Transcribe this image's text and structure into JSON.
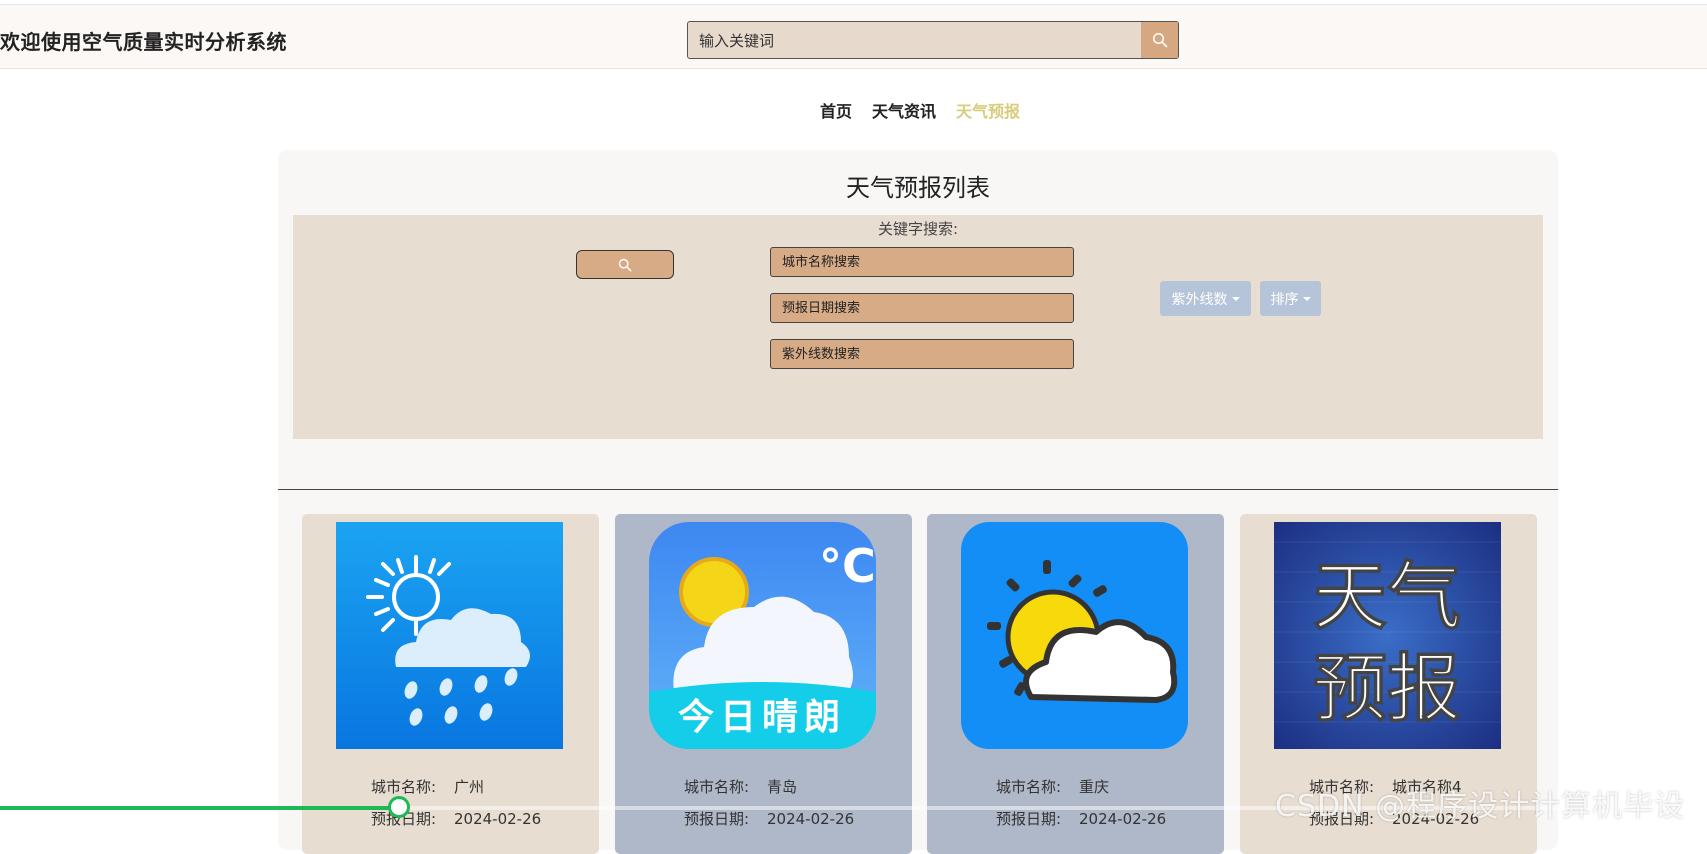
{
  "header": {
    "site_title": "欢迎使用空气质量实时分析系统",
    "search_placeholder": "输入关键词"
  },
  "nav": {
    "items": [
      {
        "label": "首页",
        "active": false
      },
      {
        "label": "天气资讯",
        "active": false
      },
      {
        "label": "天气预报",
        "active": true
      }
    ]
  },
  "page": {
    "title": "天气预报列表",
    "filter": {
      "label": "关键字搜索:",
      "city_placeholder": "城市名称搜索",
      "date_placeholder": "预报日期搜索",
      "uv_placeholder": "紫外线数搜索",
      "uv_dropdown": "紫外线数",
      "sort_dropdown": "排序"
    }
  },
  "labels": {
    "city": "城市名称:",
    "date": "预报日期:"
  },
  "cards": [
    {
      "city": "广州",
      "date": "2024-02-26",
      "image": "rain-cloud-icon",
      "bg": "#e8ddd1"
    },
    {
      "city": "青岛",
      "date": "2024-02-26",
      "image": "sunny-today-icon",
      "image_text": "今日晴朗",
      "unit": "°C",
      "bg": "#afb8c8"
    },
    {
      "city": "重庆",
      "date": "2024-02-26",
      "image": "sun-cloud-icon",
      "bg": "#afb8c8"
    },
    {
      "city": "城市名称4",
      "date": "2024-02-26",
      "image": "weather-forecast-logo",
      "image_text": [
        "天气",
        "预报"
      ],
      "bg": "#e8ddd1"
    }
  ],
  "video": {
    "progress": 0.234,
    "accent": "#1db954"
  },
  "watermark": "CSDN @程序设计计算机毕设"
}
